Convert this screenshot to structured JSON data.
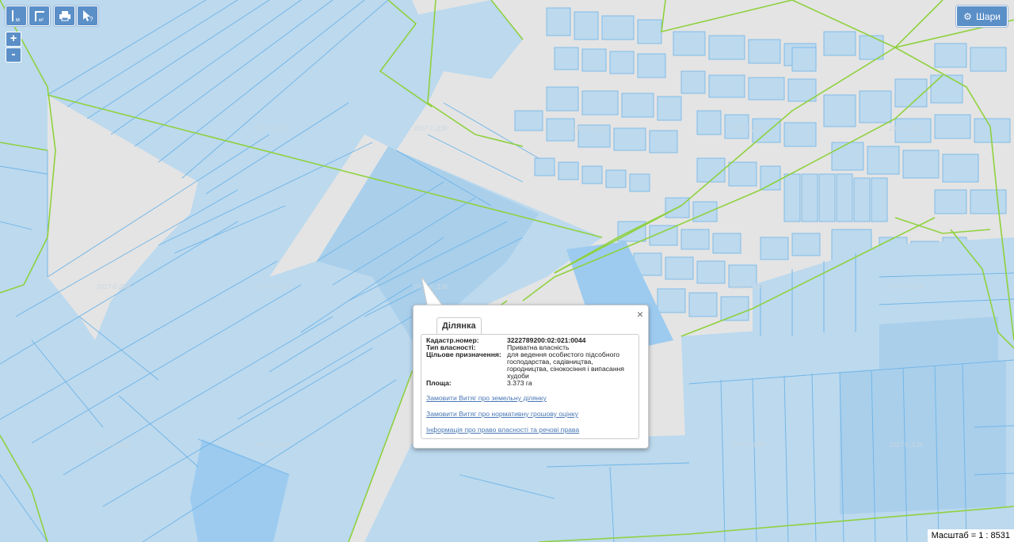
{
  "toolbar": {
    "buttons": [
      {
        "name": "measure-line-button",
        "icon": "measure-line-icon"
      },
      {
        "name": "measure-area-button",
        "icon": "measure-area-icon"
      },
      {
        "name": "print-button",
        "icon": "printer-icon"
      },
      {
        "name": "identify-button",
        "icon": "cursor-question-icon"
      }
    ]
  },
  "zoom": {
    "in_label": "+",
    "out_label": "-"
  },
  "layers": {
    "label": "Шари"
  },
  "scale": {
    "label": "Масштаб = 1 : 8531"
  },
  "watermark": {
    "text": "2017 © ДЗК"
  },
  "popup": {
    "tab_label": "Ділянка",
    "close_label": "×",
    "fields": {
      "cadastral_label": "Кадастр.номер:",
      "cadastral_value": "3222789200:02:021:0044",
      "ownership_label": "Тип власності:",
      "ownership_value": "Приватна власність",
      "purpose_label": "Цільове призначення:",
      "purpose_value": "для ведення особистого підсобного господарства, садівництва, городництва, сінокосіння і випасання худоби",
      "area_label": "Площа:",
      "area_value": "3.373 га"
    },
    "links": {
      "extract_land": "Замовити Витяг про земельну ділянку",
      "extract_valuation": "Замовити Витяг про нормативну грошову оцінку",
      "ownership_info": "Інформація про право власності та речові права"
    }
  },
  "colors": {
    "background": "#e4e4e4",
    "parcel_fill": "#bcd9ee",
    "parcel_fill_dark": "#a9cfeb",
    "parcel_highlight": "#9dcbf0",
    "parcel_stroke": "#6fb4e6",
    "boundary_green": "#8fd13e",
    "button_blue": "#5b8fc7"
  }
}
